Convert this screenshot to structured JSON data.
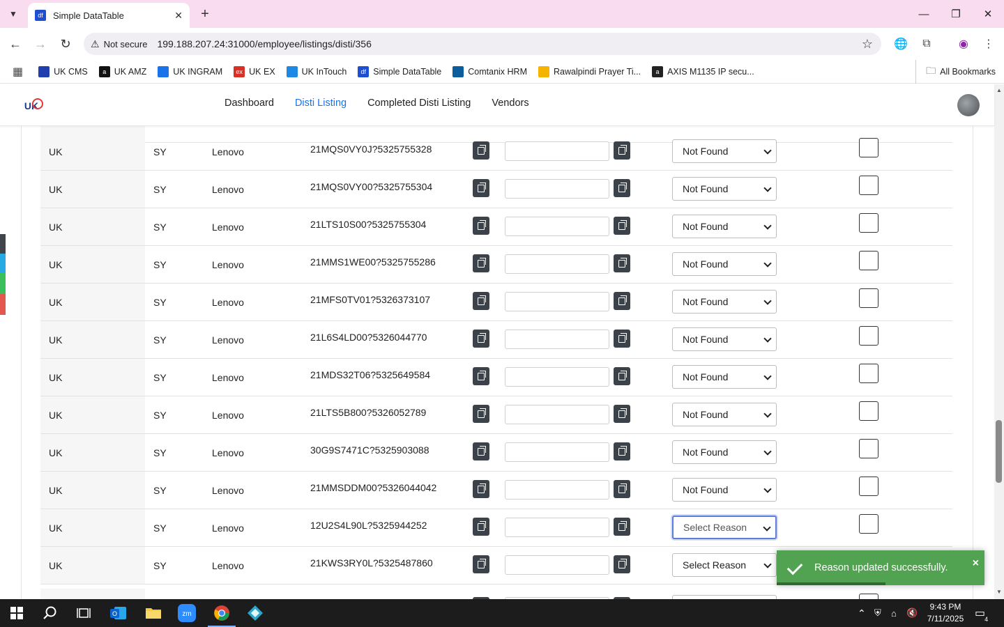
{
  "browser": {
    "tab_title": "Simple DataTable",
    "tab_favicon": "df",
    "security_label": "Not secure",
    "url": "199.188.207.24:31000/employee/listings/disti/356"
  },
  "bookmarks": [
    {
      "label": "UK CMS",
      "color": "#1f3fae",
      "icon": ""
    },
    {
      "label": "UK AMZ",
      "color": "#111111",
      "icon": "a"
    },
    {
      "label": "UK INGRAM",
      "color": "#1a73e8",
      "icon": ""
    },
    {
      "label": "UK EX",
      "color": "#d93025",
      "icon": "ex"
    },
    {
      "label": "UK InTouch",
      "color": "#1e88e5",
      "icon": ""
    },
    {
      "label": "Simple DataTable",
      "color": "#1f4fd1",
      "icon": "df"
    },
    {
      "label": "Comtanix HRM",
      "color": "#0b5d9c",
      "icon": ""
    },
    {
      "label": "Rawalpindi Prayer Ti...",
      "color": "#f4b400",
      "icon": ""
    },
    {
      "label": "AXIS M1135 IP secu...",
      "color": "#222222",
      "icon": "a"
    }
  ],
  "all_bookmarks_label": "All Bookmarks",
  "app": {
    "logo_text": "UK",
    "nav": [
      {
        "label": "Dashboard",
        "active": false
      },
      {
        "label": "Disti Listing",
        "active": true
      },
      {
        "label": "Completed Disti Listing",
        "active": false
      },
      {
        "label": "Vendors",
        "active": false
      }
    ]
  },
  "table": {
    "rows": [
      {
        "region": "UK",
        "code": "SY",
        "brand": "Lenovo",
        "sku": "21MQS0VY0J?5325755328",
        "reason": "Not Found"
      },
      {
        "region": "UK",
        "code": "SY",
        "brand": "Lenovo",
        "sku": "21MQS0VY00?5325755304",
        "reason": "Not Found"
      },
      {
        "region": "UK",
        "code": "SY",
        "brand": "Lenovo",
        "sku": "21LTS10S00?5325755304",
        "reason": "Not Found"
      },
      {
        "region": "UK",
        "code": "SY",
        "brand": "Lenovo",
        "sku": "21MMS1WE00?5325755286",
        "reason": "Not Found"
      },
      {
        "region": "UK",
        "code": "SY",
        "brand": "Lenovo",
        "sku": "21MFS0TV01?5326373107",
        "reason": "Not Found"
      },
      {
        "region": "UK",
        "code": "SY",
        "brand": "Lenovo",
        "sku": "21L6S4LD00?5326044770",
        "reason": "Not Found"
      },
      {
        "region": "UK",
        "code": "SY",
        "brand": "Lenovo",
        "sku": "21MDS32T06?5325649584",
        "reason": "Not Found"
      },
      {
        "region": "UK",
        "code": "SY",
        "brand": "Lenovo",
        "sku": "21LTS5B800?5326052789",
        "reason": "Not Found"
      },
      {
        "region": "UK",
        "code": "SY",
        "brand": "Lenovo",
        "sku": "30G9S7471C?5325903088",
        "reason": "Not Found"
      },
      {
        "region": "UK",
        "code": "SY",
        "brand": "Lenovo",
        "sku": "21MMSDDM00?5326044042",
        "reason": "Not Found"
      },
      {
        "region": "UK",
        "code": "SY",
        "brand": "Lenovo",
        "sku": "12U2S4L90L?5325944252",
        "reason": "Select Reason"
      },
      {
        "region": "UK",
        "code": "SY",
        "brand": "Lenovo",
        "sku": "21KWS3RY0L?5325487860",
        "reason": "Select Reason"
      }
    ]
  },
  "toast": {
    "message": "Reason updated successfully.",
    "close": "×",
    "color": "#51a351"
  },
  "taskbar": {
    "time": "9:43 PM",
    "date": "7/11/2025",
    "notifications": "4"
  }
}
